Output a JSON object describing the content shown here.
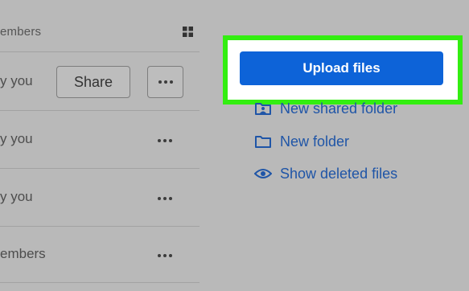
{
  "files_list": {
    "header_label": "embers",
    "rows": [
      {
        "text": "y you",
        "share_label": "Share"
      },
      {
        "text": "y you"
      },
      {
        "text": "y you"
      },
      {
        "text": "embers"
      }
    ]
  },
  "actions": {
    "upload_label": "Upload files",
    "new_shared_folder_label": "New shared folder",
    "new_folder_label": "New folder",
    "show_deleted_label": "Show deleted files"
  },
  "colors": {
    "highlight": "#33ee11",
    "primary_button": "#0d63d8",
    "link": "#1f55a7",
    "overlay": "#b9b9b9"
  },
  "icons": [
    "grid-view-icon",
    "more-options-icon",
    "shared-folder-icon",
    "folder-icon",
    "eye-icon"
  ]
}
